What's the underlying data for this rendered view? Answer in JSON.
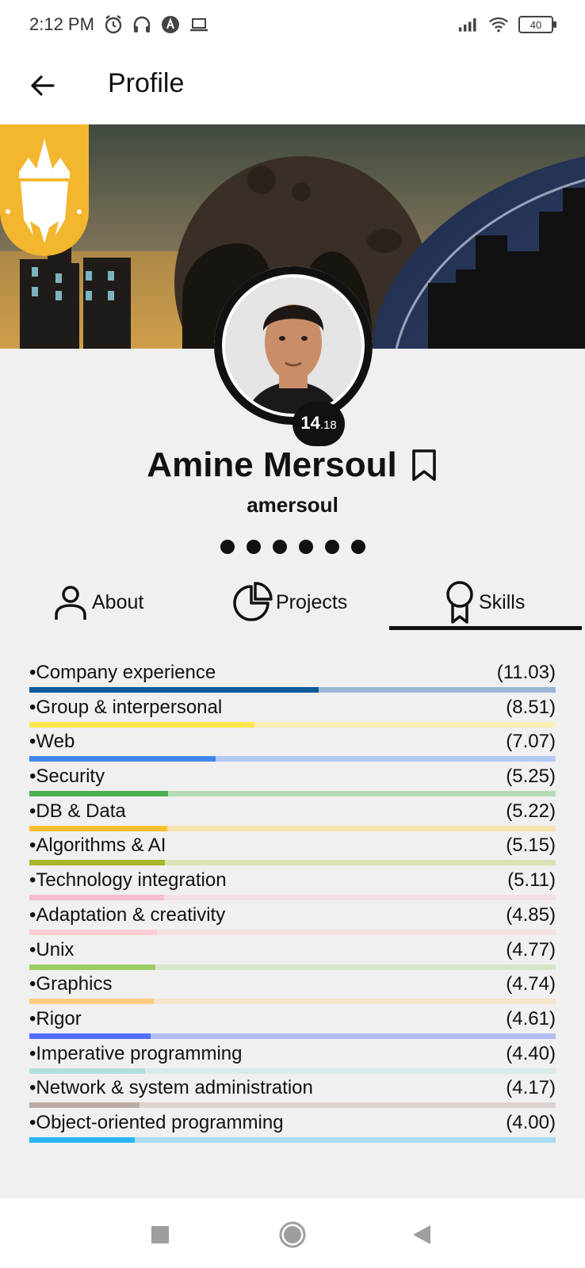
{
  "status_bar": {
    "time": "2:12 PM",
    "left_icons": [
      "alarm-icon",
      "headphones-icon",
      "app-notification-icon",
      "laptop-icon"
    ],
    "right_icons": [
      "signal-icon",
      "wifi-icon",
      "battery-icon"
    ],
    "battery_level": "40"
  },
  "app_bar": {
    "title": "Profile",
    "back_icon": "arrow-left-icon"
  },
  "profile": {
    "name": "Amine Mersoul",
    "login": "amersoul",
    "level_int": "14",
    "level_dec": ".18",
    "level_progress": 0.18,
    "bookmark_icon": "bookmark-icon",
    "pager_dots": 6
  },
  "tabs": [
    {
      "label": "About",
      "icon": "person-icon",
      "selected": false
    },
    {
      "label": "Projects",
      "icon": "pie-chart-icon",
      "selected": false
    },
    {
      "label": "Skills",
      "icon": "award-ribbon-icon",
      "selected": true
    }
  ],
  "skills": [
    {
      "name": "•Company experience",
      "level": "(11.03)",
      "fraction": 0.55,
      "color": "#0d5a9a",
      "track": "#9bb7d4"
    },
    {
      "name": "•Group & interpersonal",
      "level": "(8.51)",
      "fraction": 0.427,
      "color": "#fde74c",
      "track": "#fbf0b3"
    },
    {
      "name": "•Web",
      "level": "(7.07)",
      "fraction": 0.354,
      "color": "#3f86ef",
      "track": "#b3cbf4"
    },
    {
      "name": "•Security",
      "level": "(5.25)",
      "fraction": 0.263,
      "color": "#4caf50",
      "track": "#b5dbb6"
    },
    {
      "name": "•DB & Data",
      "level": "(5.22)",
      "fraction": 0.262,
      "color": "#fbc02d",
      "track": "#f5e3b0"
    },
    {
      "name": "•Algorithms & AI",
      "level": "(5.15)",
      "fraction": 0.258,
      "color": "#a5b528",
      "track": "#dde2b6"
    },
    {
      "name": "•Technology integration",
      "level": "(5.11)",
      "fraction": 0.256,
      "color": "#f8bbd0",
      "track": "#f3dfe6"
    },
    {
      "name": "•Adaptation & creativity",
      "level": "(4.85)",
      "fraction": 0.243,
      "color": "#ffcdd2",
      "track": "#f6e2e3"
    },
    {
      "name": "•Unix",
      "level": "(4.77)",
      "fraction": 0.239,
      "color": "#9ccc65",
      "track": "#d6e6c6"
    },
    {
      "name": "•Graphics",
      "level": "(4.74)",
      "fraction": 0.237,
      "color": "#ffcc80",
      "track": "#f5e4cc"
    },
    {
      "name": "•Rigor",
      "level": "(4.61)",
      "fraction": 0.231,
      "color": "#536dfe",
      "track": "#b2bcf5"
    },
    {
      "name": "•Imperative programming",
      "level": "(4.40)",
      "fraction": 0.22,
      "color": "#b2dfdb",
      "track": "#d9ebe9"
    },
    {
      "name": "•Network & system administration",
      "level": "(4.17)",
      "fraction": 0.209,
      "color": "#bcaaa4",
      "track": "#ddd4d1"
    },
    {
      "name": "•Object-oriented programming",
      "level": "(4.00)",
      "fraction": 0.2,
      "color": "#29b6f6",
      "track": "#a9dcf4"
    }
  ],
  "nav_bar": {
    "buttons": [
      "recents-square-icon",
      "home-circle-icon",
      "back-triangle-icon"
    ]
  }
}
